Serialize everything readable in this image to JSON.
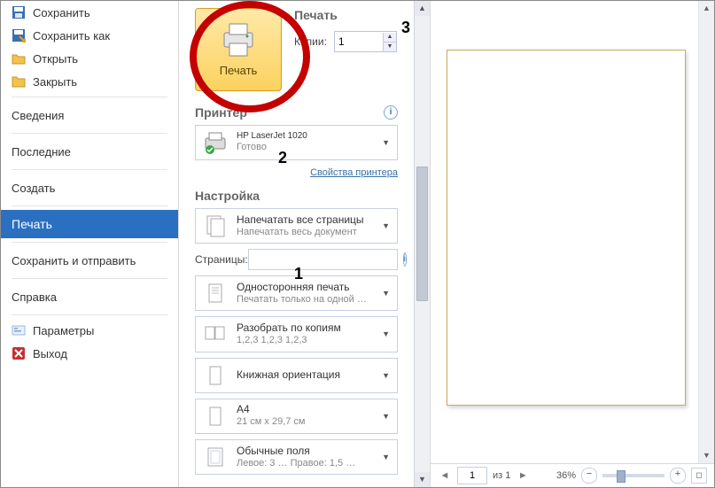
{
  "annotations": {
    "a1": "1",
    "a2": "2",
    "a3": "3"
  },
  "sidebar": {
    "save": "Сохранить",
    "save_as": "Сохранить как",
    "open": "Открыть",
    "close": "Закрыть",
    "info": "Сведения",
    "recent": "Последние",
    "new": "Создать",
    "print": "Печать",
    "share": "Сохранить и отправить",
    "help": "Справка",
    "options": "Параметры",
    "exit": "Выход"
  },
  "print": {
    "header": "Печать",
    "button": "Печать",
    "copies_label": "Копии:",
    "copies_value": "1"
  },
  "printer": {
    "header": "Принтер",
    "name": "HP LaserJet 1020",
    "status": "Готово",
    "props_link": "Свойства принтера"
  },
  "settings": {
    "header": "Настройка",
    "scope": {
      "t1": "Напечатать все страницы",
      "t2": "Напечатать весь документ"
    },
    "pages_label": "Страницы:",
    "pages_value": "",
    "sides": {
      "t1": "Односторонняя печать",
      "t2": "Печатать только на одной …"
    },
    "collate": {
      "t1": "Разобрать по копиям",
      "t2": "1,2,3   1,2,3   1,2,3"
    },
    "orient": {
      "t1": "Книжная ориентация",
      "t2": ""
    },
    "paper": {
      "t1": "A4",
      "t2": "21 см x 29,7 см"
    },
    "margins": {
      "t1": "Обычные поля",
      "t2": "Левое: 3 …   Правое: 1,5 …"
    }
  },
  "preview": {
    "page_value": "1",
    "of_label": "из 1",
    "zoom": "36%"
  }
}
